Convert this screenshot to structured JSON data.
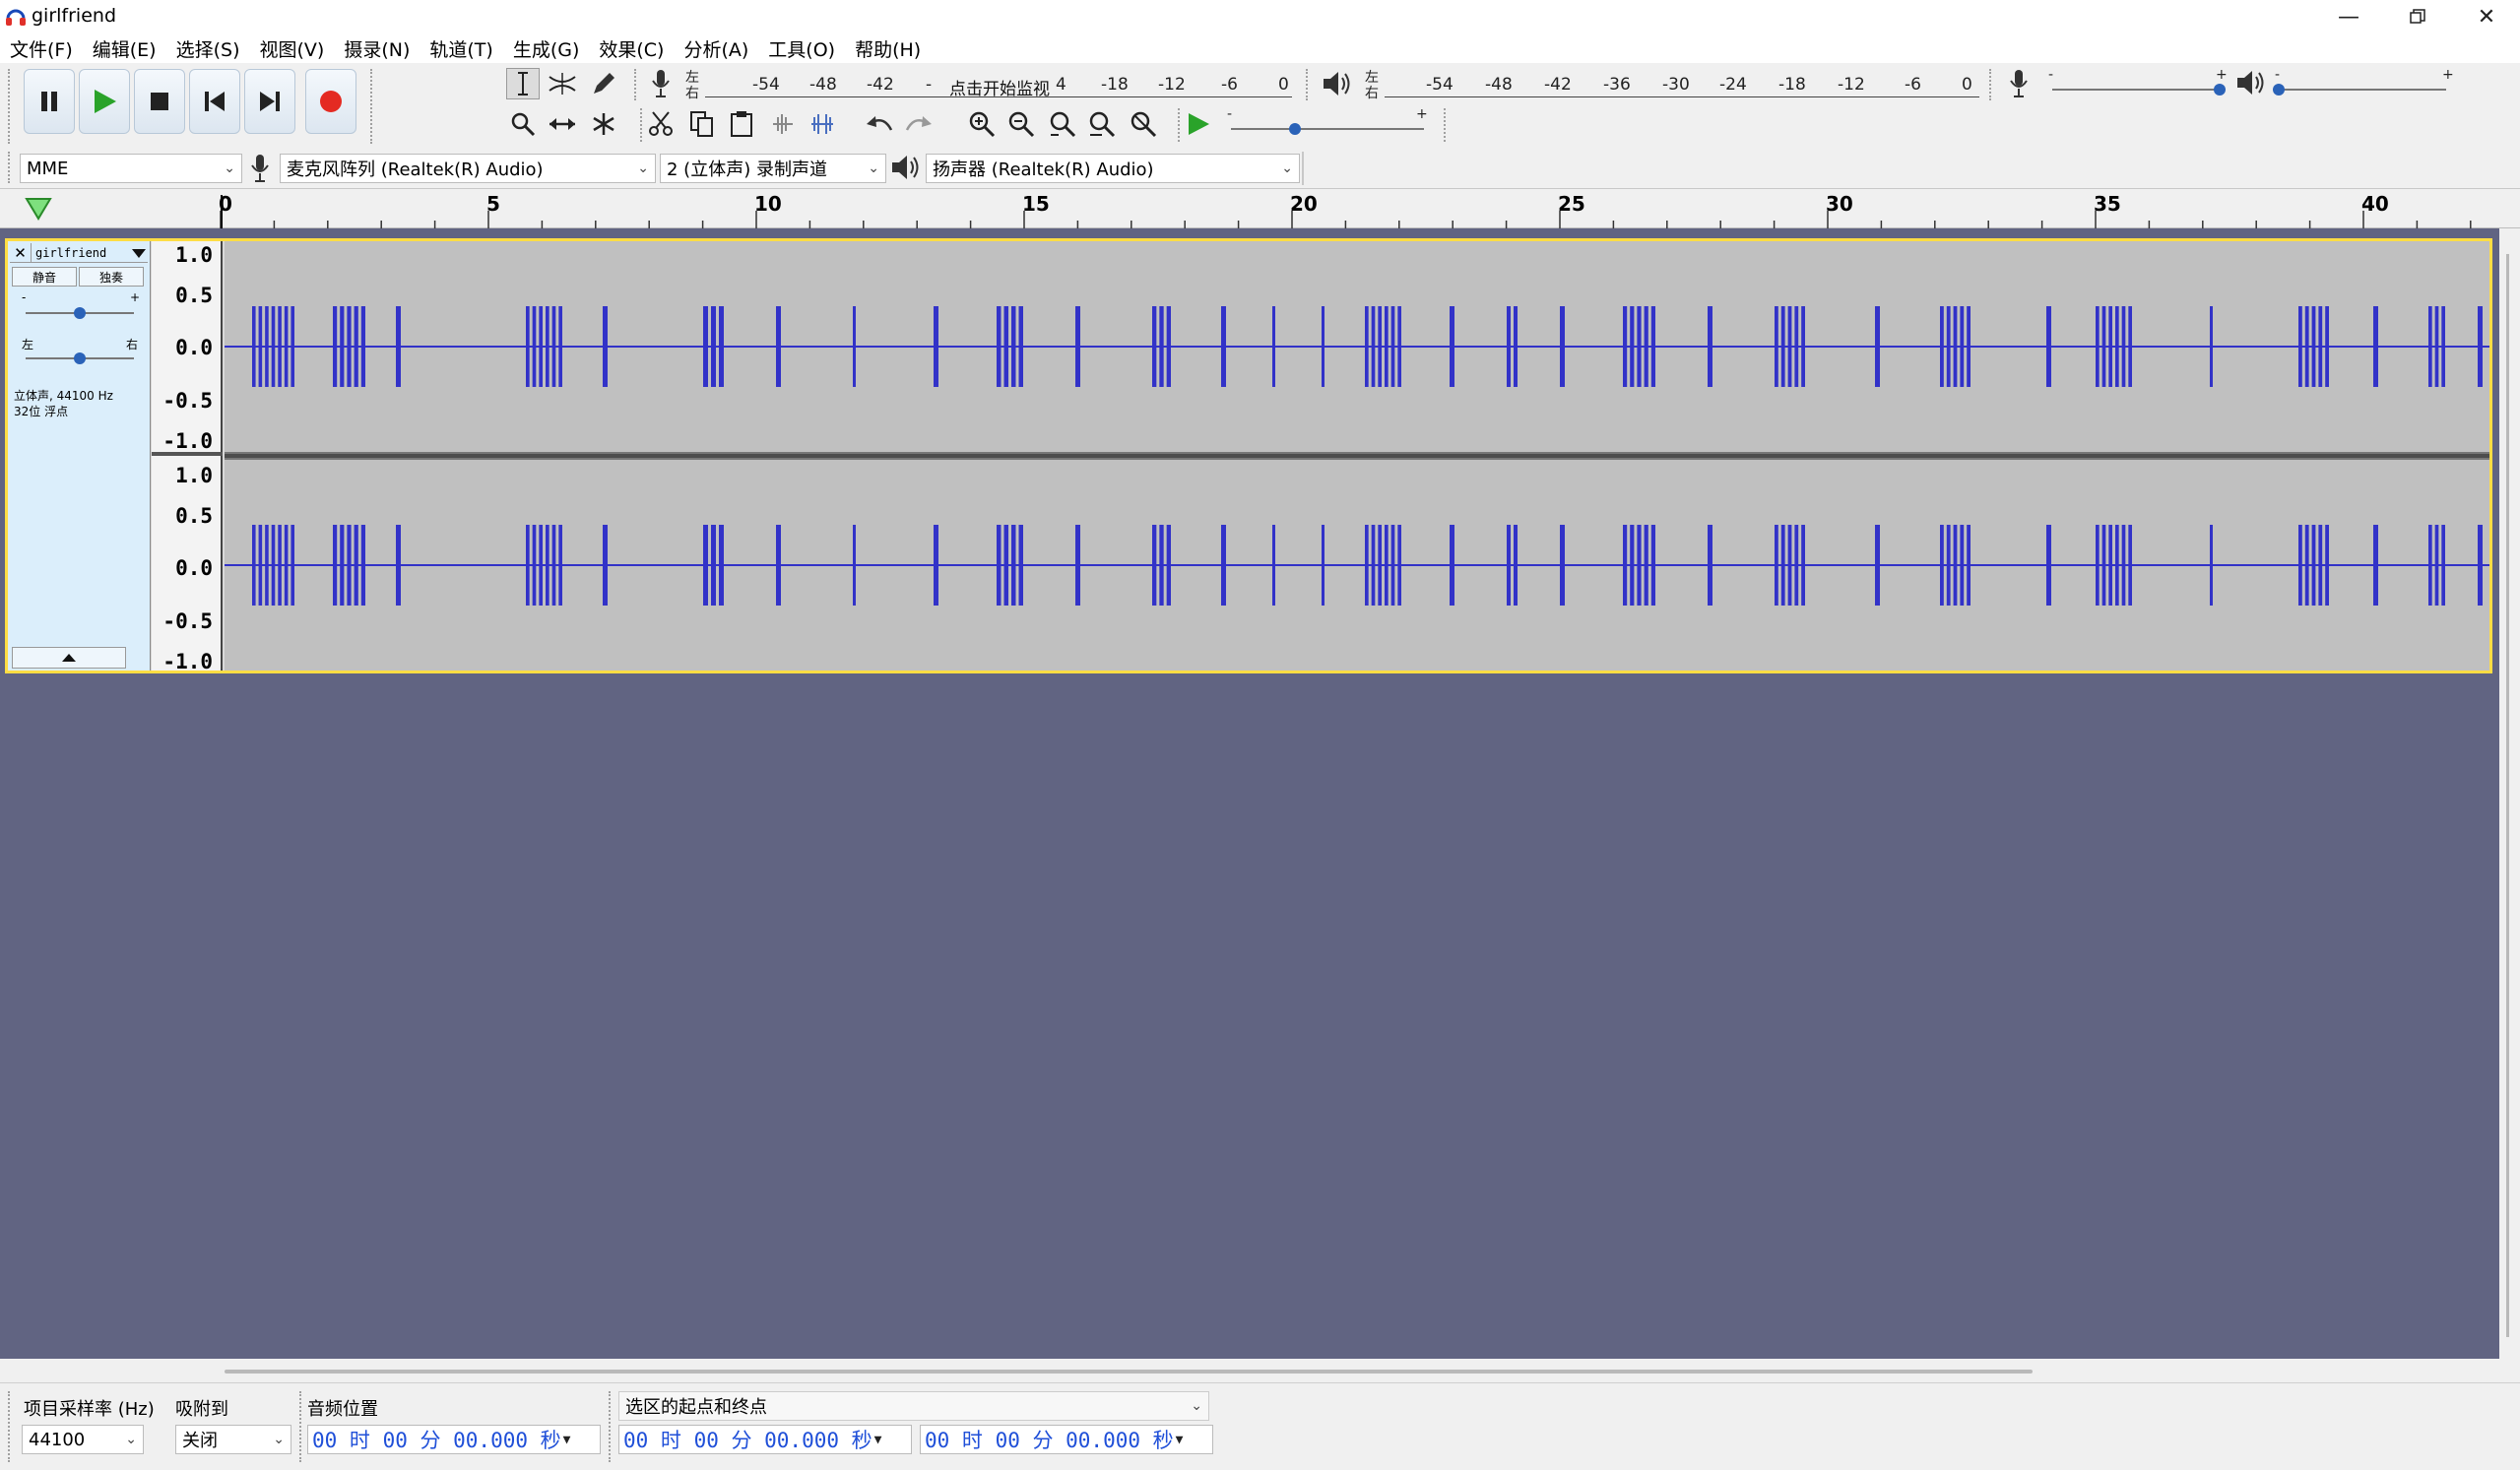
{
  "window": {
    "title": "girlfriend"
  },
  "menu": [
    "文件(F)",
    "编辑(E)",
    "选择(S)",
    "视图(V)",
    "摄录(N)",
    "轨道(T)",
    "生成(G)",
    "效果(C)",
    "分析(A)",
    "工具(O)",
    "帮助(H)"
  ],
  "record_meter": {
    "ticks": [
      "-54",
      "-48",
      "-42",
      "-",
      "4",
      "-18",
      "-12",
      "-6",
      "0"
    ],
    "lr": [
      "左",
      "右"
    ],
    "hint": "点击开始监视"
  },
  "play_meter": {
    "ticks": [
      "-54",
      "-48",
      "-42",
      "-36",
      "-30",
      "-24",
      "-18",
      "-12",
      "-6",
      "0"
    ],
    "lr": [
      "左",
      "右"
    ]
  },
  "mixer": {
    "minus": "-",
    "plus": "+",
    "record_level": 1.0,
    "playback_level": 0.0
  },
  "speed": {
    "minus": "-",
    "plus": "+",
    "level": 0.33
  },
  "devices": {
    "host": "MME",
    "input": "麦克风阵列 (Realtek(R) Audio)",
    "channels": "2 (立体声) 录制声道",
    "output": "扬声器 (Realtek(R) Audio)"
  },
  "timeline": {
    "ticks": [
      "0",
      "5",
      "10",
      "15",
      "20",
      "25",
      "30",
      "35",
      "40"
    ]
  },
  "track": {
    "name": "girlfriend",
    "mute": "静音",
    "solo": "独奏",
    "gain_minus": "-",
    "gain_plus": "+",
    "pan_left": "左",
    "pan_right": "右",
    "gain": 0.5,
    "pan": 0.5,
    "info_line1": "立体声, 44100 Hz",
    "info_line2": "32位 浮点",
    "scale": [
      "1.0",
      "0.5",
      "0.0",
      "-0.5",
      "-1.0"
    ]
  },
  "colors": {
    "waveform": "#3232c8",
    "track_bg": "#c0c0c0",
    "empty_area": "#616482",
    "selection_border": "#ffdd44"
  },
  "bottom": {
    "rate_label": "项目采样率 (Hz)",
    "rate_value": "44100",
    "snap_label": "吸附到",
    "snap_value": "关闭",
    "pos_label": "音频位置",
    "pos_value": "00 时 00 分 00.000 秒",
    "sel_label": "选区的起点和终点",
    "sel_start": "00 时 00 分 00.000 秒",
    "sel_end": "00 时 00 分 00.000 秒"
  }
}
